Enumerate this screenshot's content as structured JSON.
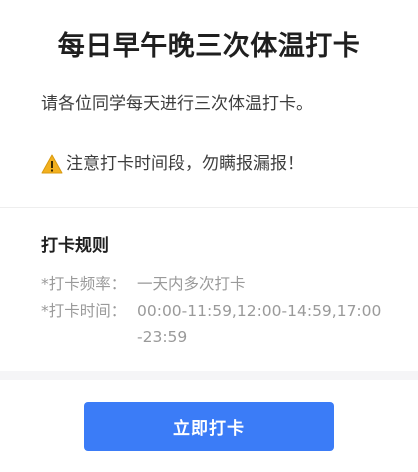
{
  "header": {
    "title": "每日早午晚三次体温打卡"
  },
  "intro": {
    "text": "请各位同学每天进行三次体温打卡。"
  },
  "notice": {
    "icon": "warning-icon",
    "text": "注意打卡时间段，勿瞒报漏报！"
  },
  "rules": {
    "heading": "打卡规则",
    "items": [
      {
        "label": "*打卡频率：",
        "value": "一天内多次打卡"
      },
      {
        "label": "*打卡时间：",
        "value": "00:00-11:59,12:00-14:59,17:00-23:59"
      }
    ]
  },
  "actions": {
    "checkin_label": "立即打卡"
  },
  "colors": {
    "accent": "#3b7cf7",
    "warning": "#f2b01e",
    "muted_text": "#9a9a9a"
  }
}
